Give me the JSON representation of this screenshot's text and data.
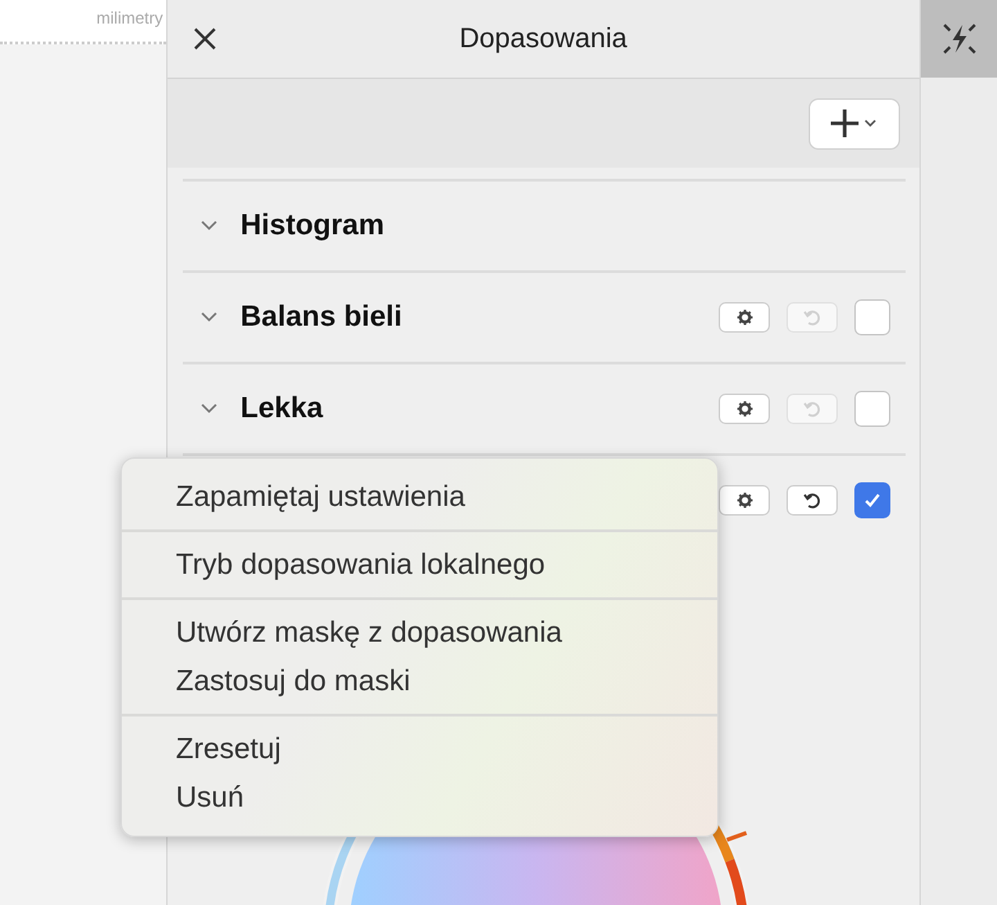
{
  "ruler": {
    "unit": "milimetry"
  },
  "panel": {
    "title": "Dopasowania"
  },
  "adjustments": [
    {
      "kind": "plain",
      "title": "Histogram"
    },
    {
      "kind": "toggle",
      "title": "Balans bieli",
      "reset_enabled": false,
      "checked": false
    },
    {
      "kind": "toggle",
      "title": "Lekka",
      "reset_enabled": false,
      "checked": false
    },
    {
      "kind": "toggle",
      "reset_enabled": true,
      "checked": true
    }
  ],
  "side_tool": {
    "selected": true
  },
  "context_menu": [
    [
      "Zapamiętaj ustawienia"
    ],
    [
      "Tryb dopasowania lokalnego"
    ],
    [
      "Utwórz maskę z dopasowania",
      "Zastosuj do maski"
    ],
    [
      "Zresetuj",
      "Usuń"
    ]
  ]
}
